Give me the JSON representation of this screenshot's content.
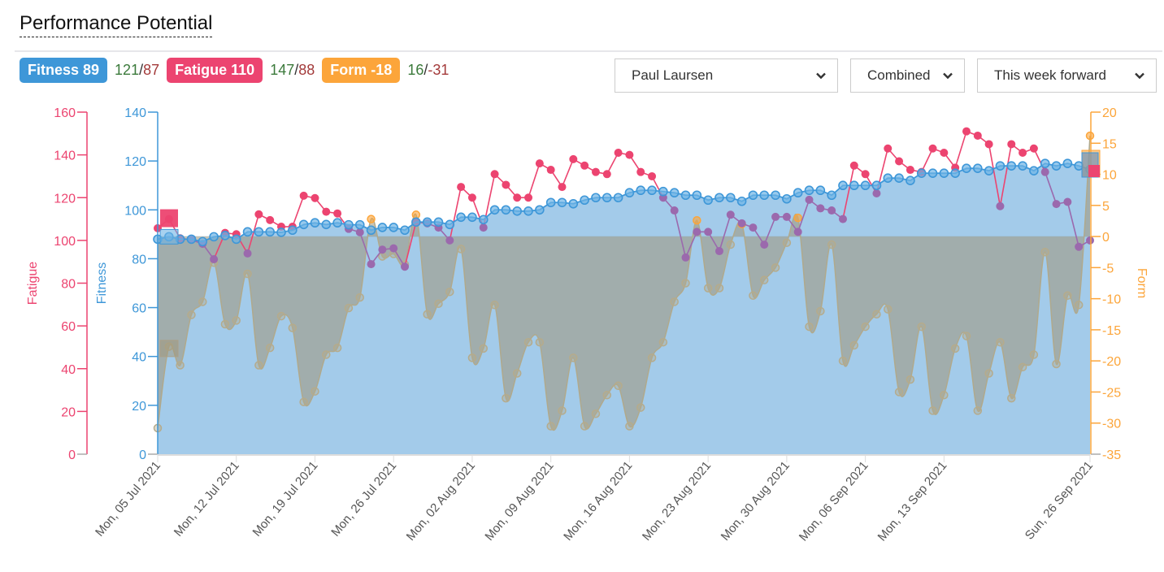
{
  "page": {
    "title": "Performance Potential"
  },
  "summary": {
    "fitness": {
      "label": "Fitness 89",
      "high": "121",
      "low": "87",
      "color": "#3e97d8"
    },
    "fatigue": {
      "label": "Fatigue 110",
      "high": "147",
      "low": "88",
      "color": "#ec4470"
    },
    "form": {
      "label": "Form -18",
      "high": "16",
      "low": "-31",
      "color": "#fca53a"
    },
    "separator": "/"
  },
  "controls": {
    "athlete": {
      "value": "Paul Laursen"
    },
    "mode": {
      "value": "Combined"
    },
    "range": {
      "value": "This week forward"
    }
  },
  "chart_data": {
    "type": "line",
    "title": "Performance Potential",
    "x_start": "2021-07-05",
    "x_end": "2021-09-26",
    "xticks": [
      "Mon, 05 Jul 2021",
      "Mon, 12 Jul 2021",
      "Mon, 19 Jul 2021",
      "Mon, 26 Jul 2021",
      "Mon, 02 Aug 2021",
      "Mon, 09 Aug 2021",
      "Mon, 16 Aug 2021",
      "Mon, 23 Aug 2021",
      "Mon, 30 Aug 2021",
      "Mon, 06 Sep 2021",
      "Mon, 13 Sep 2021",
      "Sun, 26 Sep 2021"
    ],
    "xtick_day_index": [
      0,
      7,
      14,
      21,
      28,
      35,
      42,
      49,
      56,
      63,
      70,
      83
    ],
    "axes": {
      "fatigue": {
        "label": "Fatigue",
        "range": [
          0,
          160
        ],
        "ticks": [
          0,
          20,
          40,
          60,
          80,
          100,
          120,
          140,
          160
        ],
        "position": "left-outer",
        "color": "#ec4470"
      },
      "fitness": {
        "label": "Fitness",
        "range": [
          0,
          140
        ],
        "ticks": [
          0,
          20,
          40,
          60,
          80,
          100,
          120,
          140
        ],
        "position": "left-inner",
        "color": "#3e97d8"
      },
      "form": {
        "label": "Form",
        "range": [
          -35,
          20
        ],
        "ticks": [
          -35,
          -30,
          -25,
          -20,
          -15,
          -10,
          -5,
          0,
          5,
          10,
          15,
          20
        ],
        "position": "right",
        "color": "#fca53a"
      }
    },
    "series": [
      {
        "name": "Fitness",
        "axis": "fitness",
        "color": "#3e97d8",
        "values": [
          88,
          89,
          88,
          88,
          87,
          89,
          89.5,
          88,
          91,
          91,
          91,
          90.8,
          91.7,
          94,
          94.7,
          94,
          94.7,
          93.9,
          93.9,
          91.7,
          92.8,
          92.8,
          91.7,
          95,
          95,
          95,
          94,
          97,
          97,
          96,
          100,
          100,
          99.5,
          99.5,
          100,
          103,
          103,
          102.5,
          104,
          105,
          105,
          105,
          107,
          108,
          108,
          107.5,
          107,
          106,
          106,
          104,
          105,
          105,
          103.5,
          106,
          106,
          106,
          104.5,
          107,
          108,
          108,
          106,
          110,
          110,
          110,
          110,
          113,
          113,
          112,
          115,
          115,
          115,
          115,
          117,
          117,
          116,
          118,
          118,
          118,
          116,
          119,
          118,
          119,
          118,
          116.5,
          116.5,
          114,
          114,
          115,
          119
        ]
      },
      {
        "name": "Fatigue",
        "axis": "fatigue",
        "color": "#ec4470",
        "values": [
          105.7,
          110,
          101,
          100.3,
          98.4,
          91.2,
          103.5,
          102.9,
          93.9,
          112.2,
          109.5,
          106.4,
          106.4,
          120.9,
          119.8,
          113.4,
          112.6,
          105.4,
          103.8,
          88.9,
          95.7,
          96.3,
          87.7,
          108.6,
          108,
          106,
          100,
          125,
          120,
          106,
          131,
          126,
          120,
          120,
          136,
          133,
          125,
          138,
          135,
          132,
          131,
          141,
          140,
          132,
          130,
          120,
          114,
          92,
          104,
          104,
          95,
          112,
          108,
          106,
          98,
          111,
          111,
          104,
          119,
          115,
          114,
          110,
          135,
          131,
          122,
          143,
          137,
          133,
          132,
          143,
          141,
          134,
          151,
          149,
          145,
          116,
          145,
          141,
          143,
          132,
          117,
          118,
          97,
          100,
          116
        ]
      },
      {
        "name": "Form",
        "axis": "form",
        "color": "#b5ab8c",
        "values": [
          -30.8,
          -17.7,
          -20.7,
          -12.6,
          -10.5,
          -4.2,
          -14.1,
          -13.5,
          -6.0,
          -20.7,
          -17.9,
          -12.8,
          -14.7,
          -26.6,
          -24.9,
          -19.0,
          -17.9,
          -11.5,
          -9.8,
          2.8,
          -3.2,
          -2.8,
          -4.5,
          3.5,
          -12.5,
          -10.8,
          -8.9,
          -2.0,
          -19.5,
          -18,
          -11.0,
          -26.0,
          -22,
          -17.0,
          -17.0,
          -30.5,
          -28,
          -19.5,
          -30.5,
          -28.5,
          -25.5,
          -24.0,
          -30.5,
          -27.5,
          -19.5,
          -17.0,
          -10.5,
          -7.5,
          2.6,
          -8.3,
          -8.3,
          -1.3,
          2.0,
          -9.5,
          -7.0,
          -5.0,
          -1.0,
          3.0,
          -14.5,
          -12.0,
          -1.3,
          -20.0,
          -17.5,
          -14.5,
          -12.5,
          -11.7,
          -25.0,
          -23.0,
          -14.5,
          -28.0,
          -25.5,
          -18.0,
          -16.0,
          -28.0,
          -22.0,
          -17.0,
          -26.0,
          -21.0,
          -19.0,
          -2.5,
          -20.5,
          -9.5,
          -11.0,
          16.2
        ]
      }
    ],
    "current_markers": {
      "fatigue": 110,
      "fitness": 89,
      "form": -18
    },
    "grid": false,
    "legend": "top-left (badges)"
  }
}
